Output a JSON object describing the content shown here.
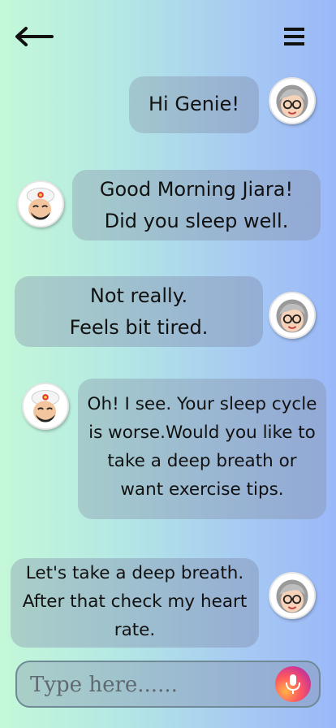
{
  "header": {
    "back_icon": "arrow-left-icon",
    "menu_icon": "hamburger-menu-icon"
  },
  "messages": [
    {
      "sender": "user",
      "avatar": "grandma-avatar",
      "lines": [
        "Hi Genie!"
      ]
    },
    {
      "sender": "genie",
      "avatar": "genie-avatar",
      "lines": [
        "Good Morning Jiara!",
        "Did you sleep well."
      ]
    },
    {
      "sender": "user",
      "avatar": "grandma-avatar",
      "lines": [
        "Not really.",
        "Feels bit tired."
      ]
    },
    {
      "sender": "genie",
      "avatar": "genie-avatar",
      "lines": [
        "Oh! I see. Your sleep cycle",
        "is worse.Would you like to",
        "take a deep breath or",
        "want exercise tips."
      ]
    },
    {
      "sender": "user",
      "avatar": "grandma-avatar",
      "lines": [
        "Let's take a deep breath.",
        "After that check my heart",
        "rate."
      ]
    }
  ],
  "composer": {
    "placeholder": "Type here......",
    "mic_icon": "microphone-icon"
  },
  "colors": {
    "background_left": "#c4f8d8",
    "background_right": "#9ab8f8",
    "mic_gradient_start": "#ffb347",
    "mic_gradient_end": "#7a3cc8"
  }
}
